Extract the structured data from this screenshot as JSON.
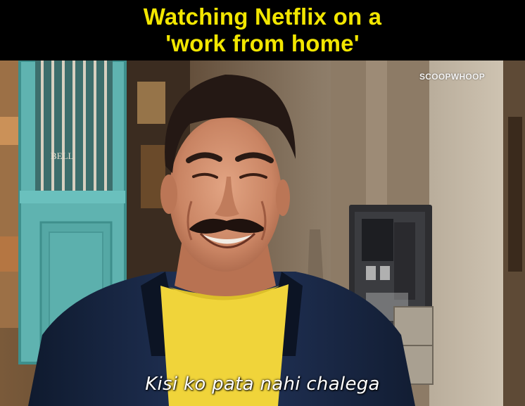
{
  "meme": {
    "caption_line1": "Watching Netflix on a",
    "caption_line2": "'work from home'",
    "subtitle": "Kisi ko pata nahi chalega",
    "watermark": "SCOOPWHOOP",
    "door_sign": "BELL"
  },
  "colors": {
    "caption_text": "#f2e600",
    "caption_bg": "#000000",
    "subtitle_text": "#ffffff",
    "door": "#5fb3b0",
    "shirt": "#f0d43a",
    "jacket": "#1c2a44"
  }
}
